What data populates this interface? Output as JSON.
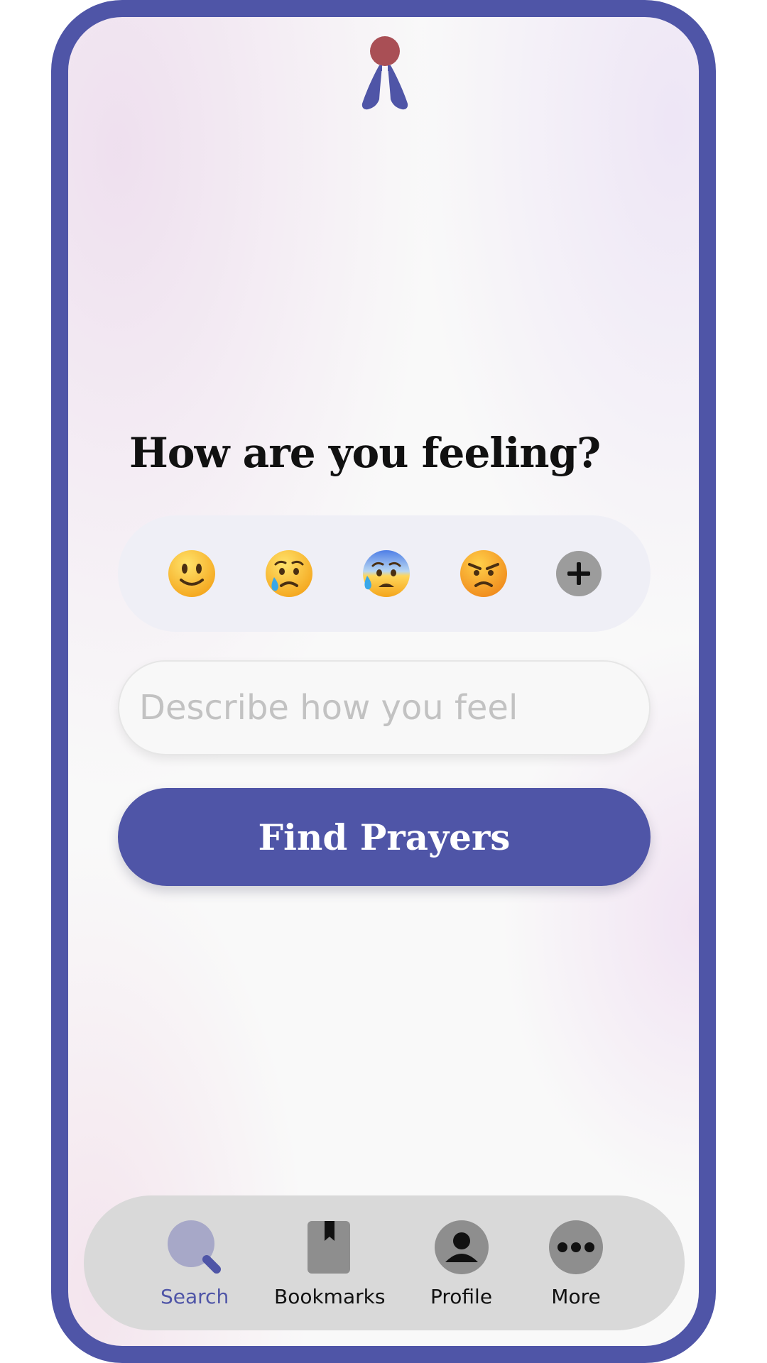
{
  "colors": {
    "brand": "#4f55a7",
    "logo_dot": "#a94f55",
    "nav_bg": "#d9d9d9",
    "emoji_card_bg": "#efeff6"
  },
  "header": {
    "logo_icon": "praying-hands-logo"
  },
  "main": {
    "title": "How are you feeling?",
    "emotions": [
      {
        "icon": "slightly-smiling-face-icon"
      },
      {
        "icon": "crying-face-icon"
      },
      {
        "icon": "anxious-face-with-sweat-icon"
      },
      {
        "icon": "angry-face-icon"
      }
    ],
    "add_emotion_icon": "plus-icon",
    "describe": {
      "placeholder": "Describe how you feel",
      "value": ""
    },
    "find_button_label": "Find Prayers"
  },
  "nav": {
    "items": [
      {
        "label": "Search",
        "icon": "search-icon",
        "active": true
      },
      {
        "label": "Bookmarks",
        "icon": "bookmark-icon",
        "active": false
      },
      {
        "label": "Profile",
        "icon": "profile-icon",
        "active": false
      },
      {
        "label": "More",
        "icon": "more-icon",
        "active": false
      }
    ]
  }
}
